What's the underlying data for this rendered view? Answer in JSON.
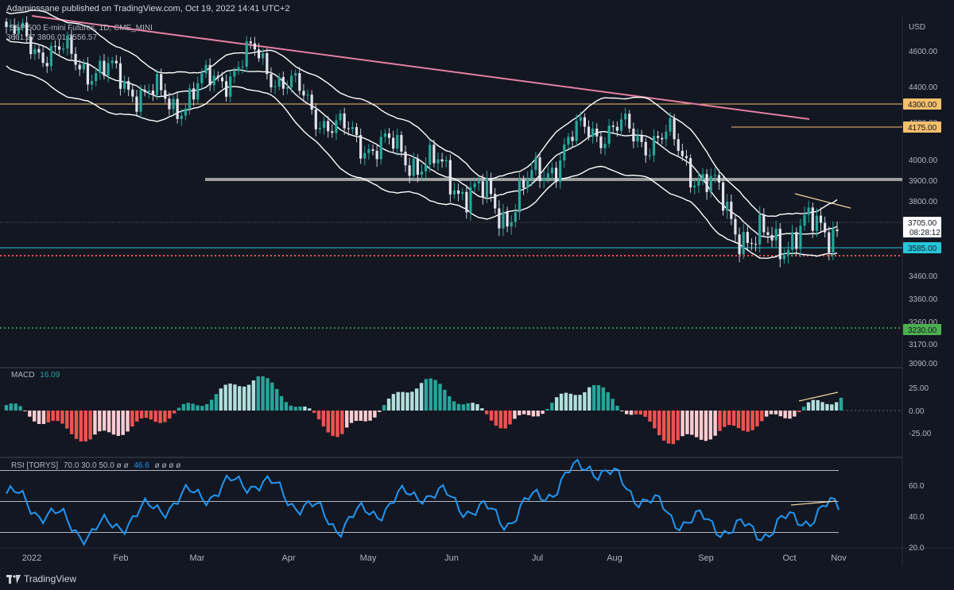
{
  "header": {
    "published": "Adaminssane published on TradingView.com, Oct 19, 2022 14:41 UTC+2",
    "symbol": "S&P 500 E-mini Futures, 1D, CME_MINI",
    "ohlc": "3661.27  3806.01  3556.57"
  },
  "price_axis": {
    "currency": "USD",
    "ticks": [
      "4600.00",
      "4400.00",
      "4200.00",
      "4000.00",
      "3900.00",
      "3800.00",
      "3460.00",
      "3360.00",
      "3260.00",
      "3170.00",
      "3090.00"
    ],
    "last_price": "3705.00",
    "countdown": "08:28:12"
  },
  "levels": [
    {
      "label": "4300.00",
      "color": "#f5bf6c"
    },
    {
      "label": "4175.00",
      "color": "#f5bf6c"
    },
    {
      "label": "3585.00",
      "color": "#26c6da"
    },
    {
      "label": "3230.00",
      "color": "#4caf50"
    }
  ],
  "macd": {
    "name": "MACD",
    "value": "16.09",
    "ticks": [
      "25.00",
      "0.00",
      "-25.00"
    ]
  },
  "rsi": {
    "name": "RSI [TORYS]",
    "params": "70.0  30.0  50.0  ø  ø",
    "value": "46.6",
    "extra": "ø  ø  ø  ø",
    "ticks": [
      "60.0",
      "40.0",
      "20.0"
    ]
  },
  "x_axis": [
    "2022",
    "Feb",
    "Mar",
    "Apr",
    "May",
    "Jun",
    "Jul",
    "Aug",
    "Sep",
    "Oct",
    "Nov"
  ],
  "footer": {
    "brand": "TradingView"
  },
  "colors": {
    "bg": "#131722",
    "up": "#26a69a",
    "down": "#ef5350",
    "rsi": "#2196f3",
    "trend": "#e57fa4",
    "gray_level": "#9e9e9e"
  },
  "chart_data": [
    {
      "type": "line",
      "title": "S&P 500 E-mini Futures, 1D",
      "ylabel": "USD",
      "x": [
        "Jan",
        "Feb",
        "Mar",
        "Apr",
        "May",
        "Jun",
        "Jul",
        "Aug",
        "Sep",
        "Oct",
        "Oct 19"
      ],
      "series": [
        {
          "values": [
            4700,
            4520,
            4300,
            4580,
            4150,
            4000,
            3750,
            4180,
            4100,
            3600,
            3705
          ]
        }
      ],
      "levels": [
        4300,
        4175,
        3900,
        3585,
        3230
      ]
    },
    {
      "type": "bar",
      "title": "MACD",
      "x": [
        "Jan",
        "Feb",
        "Mar",
        "Apr",
        "May",
        "Jun",
        "Jul",
        "Aug",
        "Sep",
        "Oct",
        "Oct 19"
      ],
      "values": [
        6,
        -32,
        -4,
        38,
        -28,
        35,
        -18,
        29,
        -35,
        -15,
        16.09
      ]
    },
    {
      "type": "line",
      "title": "RSI [TORYS]",
      "x": [
        "Jan",
        "Feb",
        "Mar",
        "Apr",
        "May",
        "Jun",
        "Jul",
        "Aug",
        "Sep",
        "Oct",
        "Oct 19"
      ],
      "values": [
        55,
        29,
        50,
        64,
        35,
        57,
        38,
        75,
        40,
        30,
        46.6
      ],
      "bands": [
        70,
        50,
        30
      ]
    }
  ]
}
